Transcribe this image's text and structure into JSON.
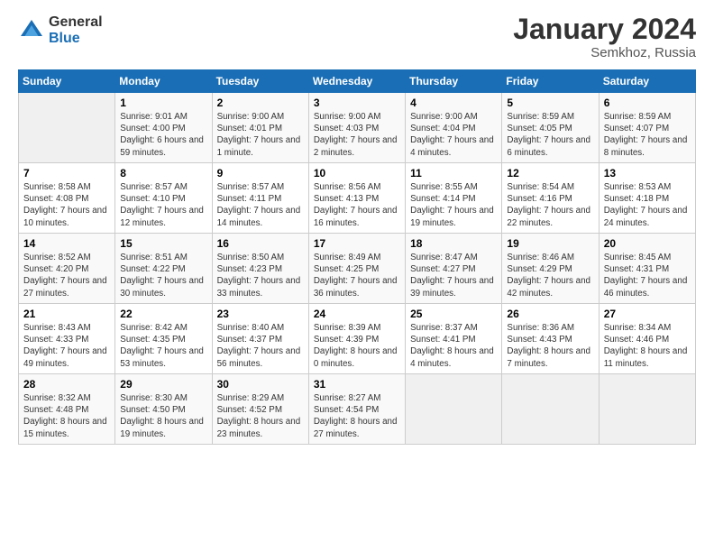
{
  "header": {
    "logo_general": "General",
    "logo_blue": "Blue",
    "month_title": "January 2024",
    "location": "Semkhoz, Russia"
  },
  "calendar": {
    "headers": [
      "Sunday",
      "Monday",
      "Tuesday",
      "Wednesday",
      "Thursday",
      "Friday",
      "Saturday"
    ],
    "rows": [
      [
        {
          "day": "",
          "empty": true
        },
        {
          "day": "1",
          "sunrise": "Sunrise: 9:01 AM",
          "sunset": "Sunset: 4:00 PM",
          "daylight": "Daylight: 6 hours and 59 minutes."
        },
        {
          "day": "2",
          "sunrise": "Sunrise: 9:00 AM",
          "sunset": "Sunset: 4:01 PM",
          "daylight": "Daylight: 7 hours and 1 minute."
        },
        {
          "day": "3",
          "sunrise": "Sunrise: 9:00 AM",
          "sunset": "Sunset: 4:03 PM",
          "daylight": "Daylight: 7 hours and 2 minutes."
        },
        {
          "day": "4",
          "sunrise": "Sunrise: 9:00 AM",
          "sunset": "Sunset: 4:04 PM",
          "daylight": "Daylight: 7 hours and 4 minutes."
        },
        {
          "day": "5",
          "sunrise": "Sunrise: 8:59 AM",
          "sunset": "Sunset: 4:05 PM",
          "daylight": "Daylight: 7 hours and 6 minutes."
        },
        {
          "day": "6",
          "sunrise": "Sunrise: 8:59 AM",
          "sunset": "Sunset: 4:07 PM",
          "daylight": "Daylight: 7 hours and 8 minutes."
        }
      ],
      [
        {
          "day": "7",
          "sunrise": "Sunrise: 8:58 AM",
          "sunset": "Sunset: 4:08 PM",
          "daylight": "Daylight: 7 hours and 10 minutes."
        },
        {
          "day": "8",
          "sunrise": "Sunrise: 8:57 AM",
          "sunset": "Sunset: 4:10 PM",
          "daylight": "Daylight: 7 hours and 12 minutes."
        },
        {
          "day": "9",
          "sunrise": "Sunrise: 8:57 AM",
          "sunset": "Sunset: 4:11 PM",
          "daylight": "Daylight: 7 hours and 14 minutes."
        },
        {
          "day": "10",
          "sunrise": "Sunrise: 8:56 AM",
          "sunset": "Sunset: 4:13 PM",
          "daylight": "Daylight: 7 hours and 16 minutes."
        },
        {
          "day": "11",
          "sunrise": "Sunrise: 8:55 AM",
          "sunset": "Sunset: 4:14 PM",
          "daylight": "Daylight: 7 hours and 19 minutes."
        },
        {
          "day": "12",
          "sunrise": "Sunrise: 8:54 AM",
          "sunset": "Sunset: 4:16 PM",
          "daylight": "Daylight: 7 hours and 22 minutes."
        },
        {
          "day": "13",
          "sunrise": "Sunrise: 8:53 AM",
          "sunset": "Sunset: 4:18 PM",
          "daylight": "Daylight: 7 hours and 24 minutes."
        }
      ],
      [
        {
          "day": "14",
          "sunrise": "Sunrise: 8:52 AM",
          "sunset": "Sunset: 4:20 PM",
          "daylight": "Daylight: 7 hours and 27 minutes."
        },
        {
          "day": "15",
          "sunrise": "Sunrise: 8:51 AM",
          "sunset": "Sunset: 4:22 PM",
          "daylight": "Daylight: 7 hours and 30 minutes."
        },
        {
          "day": "16",
          "sunrise": "Sunrise: 8:50 AM",
          "sunset": "Sunset: 4:23 PM",
          "daylight": "Daylight: 7 hours and 33 minutes."
        },
        {
          "day": "17",
          "sunrise": "Sunrise: 8:49 AM",
          "sunset": "Sunset: 4:25 PM",
          "daylight": "Daylight: 7 hours and 36 minutes."
        },
        {
          "day": "18",
          "sunrise": "Sunrise: 8:47 AM",
          "sunset": "Sunset: 4:27 PM",
          "daylight": "Daylight: 7 hours and 39 minutes."
        },
        {
          "day": "19",
          "sunrise": "Sunrise: 8:46 AM",
          "sunset": "Sunset: 4:29 PM",
          "daylight": "Daylight: 7 hours and 42 minutes."
        },
        {
          "day": "20",
          "sunrise": "Sunrise: 8:45 AM",
          "sunset": "Sunset: 4:31 PM",
          "daylight": "Daylight: 7 hours and 46 minutes."
        }
      ],
      [
        {
          "day": "21",
          "sunrise": "Sunrise: 8:43 AM",
          "sunset": "Sunset: 4:33 PM",
          "daylight": "Daylight: 7 hours and 49 minutes."
        },
        {
          "day": "22",
          "sunrise": "Sunrise: 8:42 AM",
          "sunset": "Sunset: 4:35 PM",
          "daylight": "Daylight: 7 hours and 53 minutes."
        },
        {
          "day": "23",
          "sunrise": "Sunrise: 8:40 AM",
          "sunset": "Sunset: 4:37 PM",
          "daylight": "Daylight: 7 hours and 56 minutes."
        },
        {
          "day": "24",
          "sunrise": "Sunrise: 8:39 AM",
          "sunset": "Sunset: 4:39 PM",
          "daylight": "Daylight: 8 hours and 0 minutes."
        },
        {
          "day": "25",
          "sunrise": "Sunrise: 8:37 AM",
          "sunset": "Sunset: 4:41 PM",
          "daylight": "Daylight: 8 hours and 4 minutes."
        },
        {
          "day": "26",
          "sunrise": "Sunrise: 8:36 AM",
          "sunset": "Sunset: 4:43 PM",
          "daylight": "Daylight: 8 hours and 7 minutes."
        },
        {
          "day": "27",
          "sunrise": "Sunrise: 8:34 AM",
          "sunset": "Sunset: 4:46 PM",
          "daylight": "Daylight: 8 hours and 11 minutes."
        }
      ],
      [
        {
          "day": "28",
          "sunrise": "Sunrise: 8:32 AM",
          "sunset": "Sunset: 4:48 PM",
          "daylight": "Daylight: 8 hours and 15 minutes."
        },
        {
          "day": "29",
          "sunrise": "Sunrise: 8:30 AM",
          "sunset": "Sunset: 4:50 PM",
          "daylight": "Daylight: 8 hours and 19 minutes."
        },
        {
          "day": "30",
          "sunrise": "Sunrise: 8:29 AM",
          "sunset": "Sunset: 4:52 PM",
          "daylight": "Daylight: 8 hours and 23 minutes."
        },
        {
          "day": "31",
          "sunrise": "Sunrise: 8:27 AM",
          "sunset": "Sunset: 4:54 PM",
          "daylight": "Daylight: 8 hours and 27 minutes."
        },
        {
          "day": "",
          "empty": true
        },
        {
          "day": "",
          "empty": true
        },
        {
          "day": "",
          "empty": true
        }
      ]
    ]
  }
}
